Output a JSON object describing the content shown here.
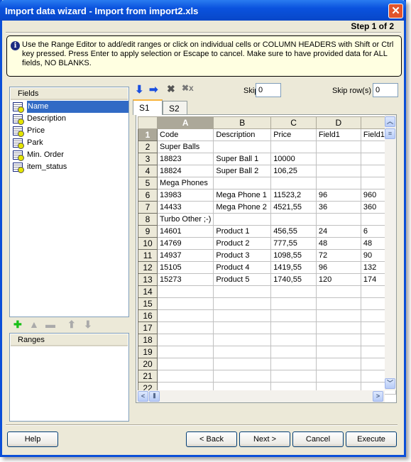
{
  "window": {
    "title": "Import data wizard - Import from import2.xls",
    "close": "✕",
    "step": "Step 1 of 2"
  },
  "info": {
    "icon": "info-icon",
    "text": "Use the Range Editor to add/edit ranges or click on individual cells or COLUMN HEADERS with Shift or Ctrl key pressed. Press Enter to apply selection or Escape to cancel. Make sure to have provided data for ALL fields, NO BLANKS."
  },
  "fields": {
    "header": "Fields",
    "items": [
      "Name",
      "Description",
      "Price",
      "Park",
      "Min. Order",
      "item_status"
    ],
    "selected": "Name"
  },
  "ranges": {
    "header": "Ranges"
  },
  "toolbar": {
    "skip_cols_label": "Skip col(s)",
    "skip_cols": "0",
    "skip_rows_label": "Skip row(s)",
    "skip_rows": "0"
  },
  "tabs": [
    "S1",
    "S2"
  ],
  "grid": {
    "columns": [
      "A",
      "B",
      "C",
      "D",
      ""
    ],
    "rows": [
      [
        "Code",
        "Description",
        "Price",
        "Field1",
        "Field1"
      ],
      [
        "Super Balls",
        "",
        "",
        "",
        ""
      ],
      [
        "18823",
        "Super Ball 1",
        "10000",
        "",
        ""
      ],
      [
        "18824",
        "Super Ball 2",
        "106,25",
        "",
        ""
      ],
      [
        "Mega Phones",
        "",
        "",
        "",
        ""
      ],
      [
        "13983",
        "Mega Phone 1",
        "11523,2",
        "96",
        "960"
      ],
      [
        "14433",
        "Mega Phone 2",
        "4521,55",
        "36",
        "360"
      ],
      [
        "Turbo Other ;-)",
        "",
        "",
        "",
        ""
      ],
      [
        "14601",
        "Product 1",
        "456,55",
        "24",
        "6"
      ],
      [
        "14769",
        "Product 2",
        "777,55",
        "48",
        "48"
      ],
      [
        "14937",
        "Product 3",
        "1098,55",
        "72",
        "90"
      ],
      [
        "15105",
        "Product 4",
        "1419,55",
        "96",
        "132"
      ],
      [
        "15273",
        "Product 5",
        "1740,55",
        "120",
        "174"
      ],
      [
        "",
        "",
        "",
        "",
        ""
      ],
      [
        "",
        "",
        "",
        "",
        ""
      ],
      [
        "",
        "",
        "",
        "",
        ""
      ],
      [
        "",
        "",
        "",
        "",
        ""
      ],
      [
        "",
        "",
        "",
        "",
        ""
      ],
      [
        "",
        "",
        "",
        "",
        ""
      ],
      [
        "",
        "",
        "",
        "",
        ""
      ],
      [
        "",
        "",
        "",
        "",
        ""
      ],
      [
        "",
        "",
        "",
        "",
        ""
      ]
    ]
  },
  "buttons": {
    "help": "Help",
    "back": "< Back",
    "next": "Next >",
    "cancel": "Cancel",
    "execute": "Execute"
  }
}
